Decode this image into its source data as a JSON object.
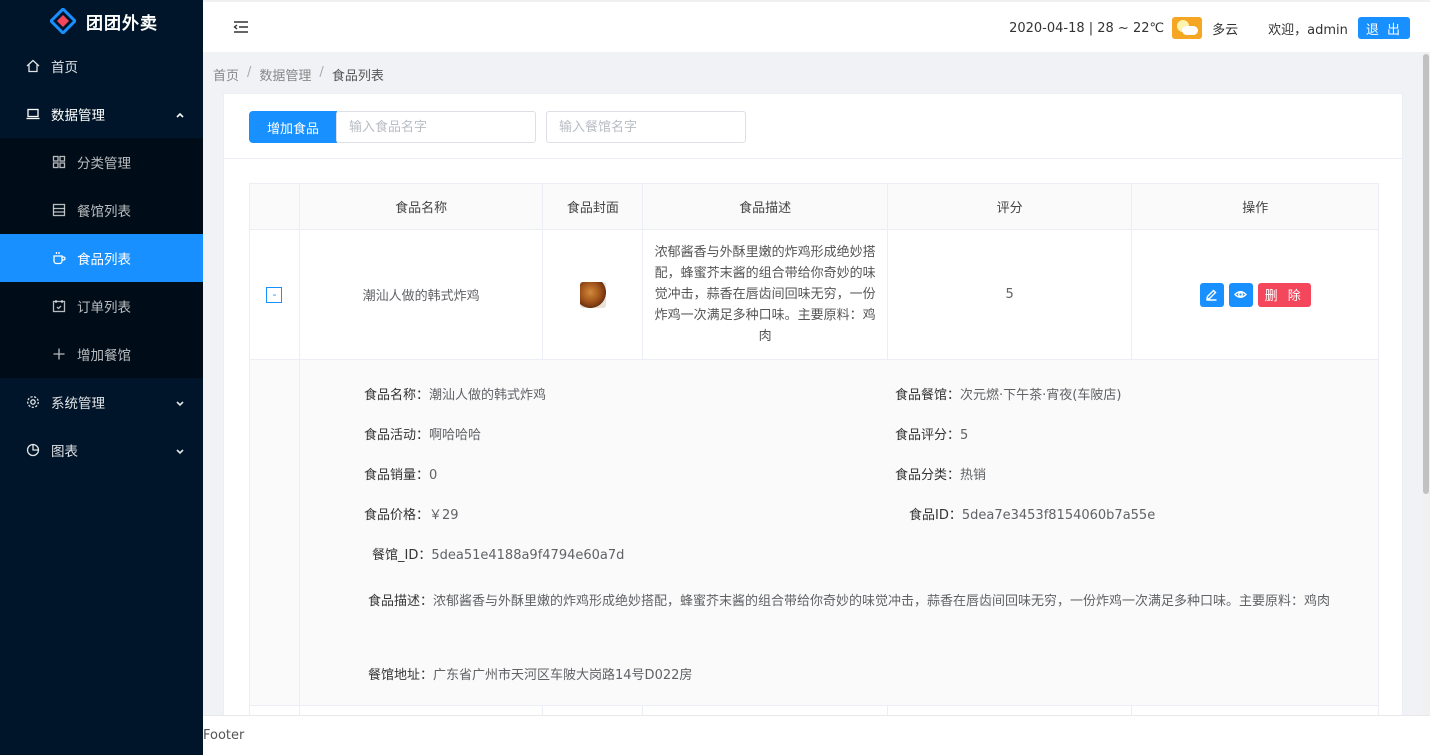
{
  "app": {
    "title": "团团外卖"
  },
  "sidebar": {
    "items": [
      {
        "label": "首页",
        "icon": "home-icon"
      },
      {
        "label": "数据管理",
        "icon": "laptop-icon",
        "expanded": true,
        "children": [
          {
            "label": "分类管理",
            "icon": "grid-icon"
          },
          {
            "label": "餐馆列表",
            "icon": "store-icon"
          },
          {
            "label": "食品列表",
            "icon": "coffee-icon",
            "active": true
          },
          {
            "label": "订单列表",
            "icon": "calendar-icon"
          },
          {
            "label": "增加餐馆",
            "icon": "plus-icon"
          }
        ]
      },
      {
        "label": "系统管理",
        "icon": "gear-icon"
      },
      {
        "label": "图表",
        "icon": "pie-chart-icon"
      }
    ]
  },
  "header": {
    "weather": "2020-04-18 | 28 ~ 22℃",
    "weather_desc": "多云",
    "welcome": "欢迎，admin",
    "logout": "退 出"
  },
  "breadcrumb": [
    "首页",
    "数据管理",
    "食品列表"
  ],
  "toolbar": {
    "add_label": "增加食品",
    "food_placeholder": "输入食品名字",
    "shop_placeholder": "输入餐馆名字"
  },
  "table": {
    "columns": [
      "食品名称",
      "食品封面",
      "食品描述",
      "评分",
      "操作"
    ],
    "rows": [
      {
        "expand": "-",
        "name": "潮汕人做的韩式炸鸡",
        "description": "浓郁酱香与外酥里嫩的炸鸡形成绝妙搭配，蜂蜜芥末酱的组合带给你奇妙的味觉冲击，蒜香在唇齿间回味无穷，一份炸鸡一次满足多种口味。主要原料：鸡肉",
        "rating": "5",
        "delete_label": "删 除"
      }
    ]
  },
  "detail": {
    "food_name": {
      "label": "食品名称：",
      "value": "潮汕人做的韩式炸鸡"
    },
    "shop": {
      "label": "食品餐馆：",
      "value": "次元燃·下午茶·宵夜(车陂店)"
    },
    "activity": {
      "label": "食品活动：",
      "value": "啊哈哈哈"
    },
    "rating": {
      "label": "食品评分：",
      "value": "5"
    },
    "sales": {
      "label": "食品销量：",
      "value": "0"
    },
    "category": {
      "label": "食品分类：",
      "value": "热销"
    },
    "price": {
      "label": "食品价格：",
      "value": "￥29"
    },
    "food_id": {
      "label": "食品ID：",
      "value": "5dea7e3453f8154060b7a55e"
    },
    "shop_id": {
      "label": "餐馆_ID：",
      "value": "5dea51e4188a9f4794e60a7d"
    },
    "description": {
      "label": "食品描述：",
      "value": "浓郁酱香与外酥里嫩的炸鸡形成绝妙搭配，蜂蜜芥末酱的组合带给你奇妙的味觉冲击，蒜香在唇齿间回味无穷，一份炸鸡一次满足多种口味。主要原料：鸡肉"
    },
    "address": {
      "label": "餐馆地址：",
      "value": "广东省广州市天河区车陂大岗路14号D022房"
    }
  },
  "footer": {
    "text": "Footer"
  },
  "colors": {
    "sidebar_bg": "#001529",
    "primary": "#1890ff",
    "danger": "#f5475b"
  }
}
